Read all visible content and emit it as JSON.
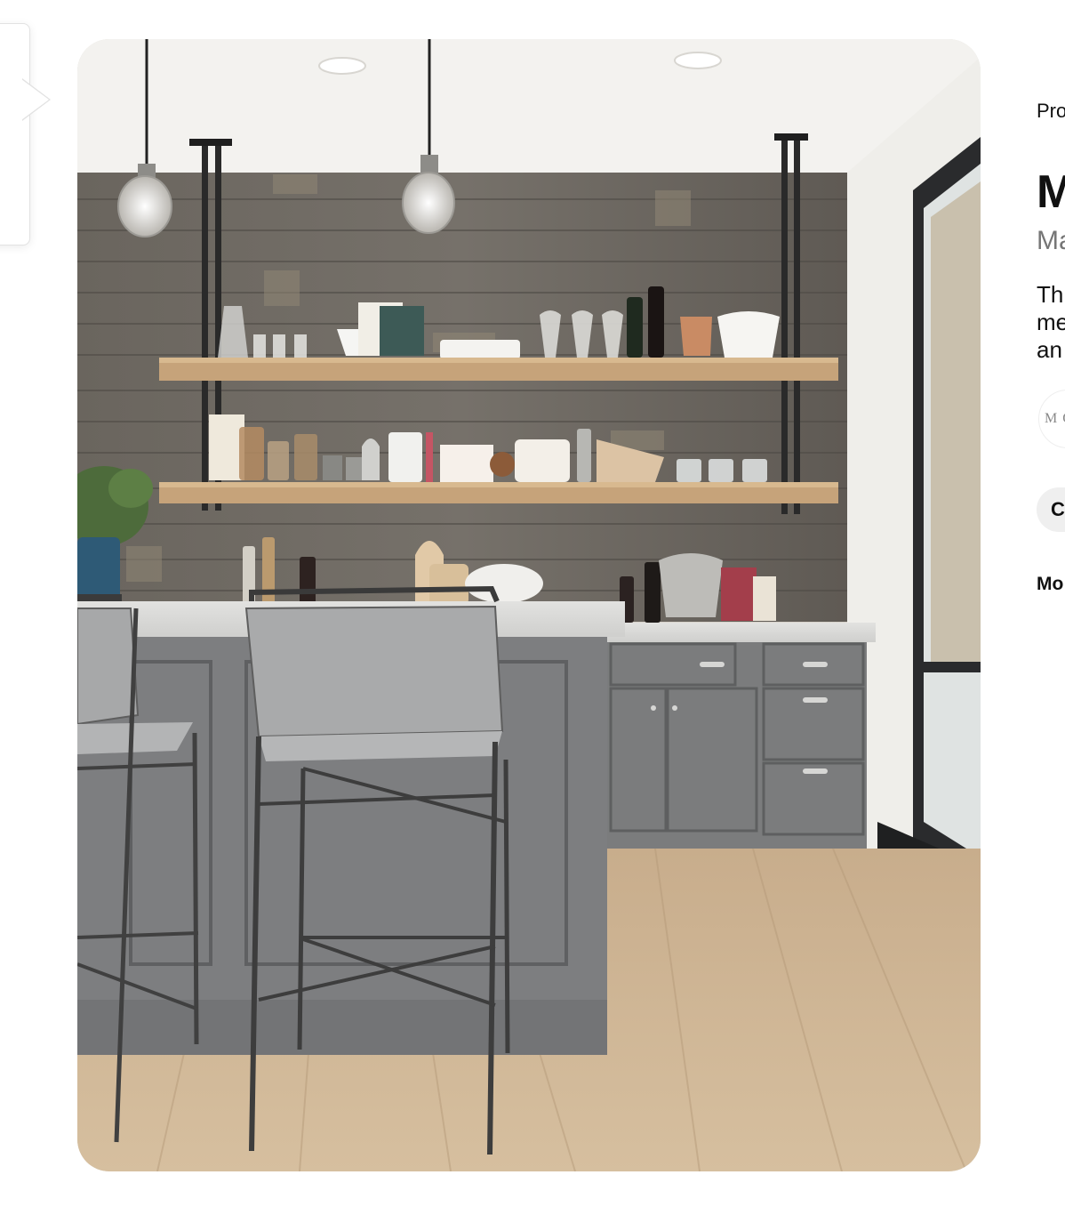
{
  "image": {
    "alt": ""
  },
  "details": {
    "source_label": "Pro",
    "title": "M",
    "subtitle": "Ma",
    "description_lines": [
      "Th",
      "me",
      "an"
    ],
    "avatar_text": "M O",
    "action_button_label": "C",
    "more_label": "Mo"
  },
  "colors": {
    "wall_wood": "#6b655c",
    "cabinet_gray": "#7a7b7b",
    "floor_oak": "#cbb293",
    "counter": "#d9d9d7",
    "shelf_wood": "#c9a981"
  },
  "icons": {
    "popover": "popover-card"
  }
}
